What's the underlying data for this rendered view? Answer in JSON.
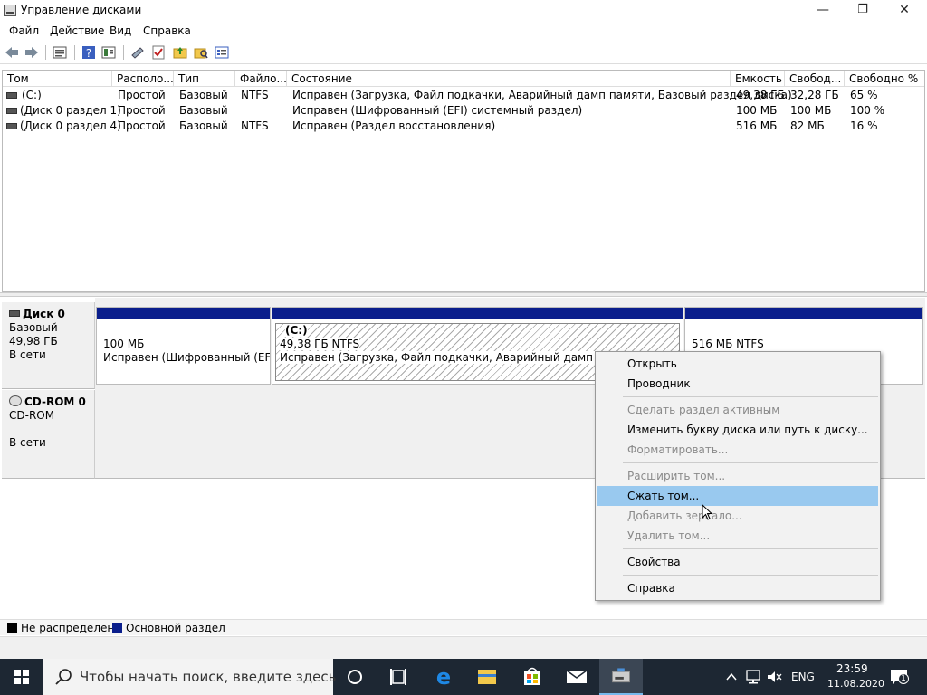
{
  "window": {
    "title": "Управление дисками",
    "minimize": "—",
    "maximize": "❐",
    "close": "✕"
  },
  "menu": [
    "Файл",
    "Действие",
    "Вид",
    "Справка"
  ],
  "list": {
    "columns": [
      "Том",
      "Располо...",
      "Тип",
      "Файло...",
      "Состояние",
      "Емкость",
      "Свобод...",
      "Свободно %"
    ],
    "rows": [
      [
        "(C:)",
        "Простой",
        "Базовый",
        "NTFS",
        "Исправен (Загрузка, Файл подкачки, Аварийный дамп памяти, Базовый раздел диска)",
        "49,38 ГБ",
        "32,28 ГБ",
        "65 %"
      ],
      [
        "(Диск 0 раздел 1)",
        "Простой",
        "Базовый",
        "",
        "Исправен (Шифрованный (EFI) системный раздел)",
        "100 МБ",
        "100 МБ",
        "100 %"
      ],
      [
        "(Диск 0 раздел 4)",
        "Простой",
        "Базовый",
        "NTFS",
        "Исправен (Раздел восстановления)",
        "516 МБ",
        "82 МБ",
        "16 %"
      ]
    ]
  },
  "disk0": {
    "name": "Диск 0",
    "type": "Базовый",
    "size": "49,98 ГБ",
    "status": "В сети",
    "p1": {
      "size": "100 МБ",
      "status": "Исправен (Шифрованный (EFI) с"
    },
    "p2": {
      "label": "(C:)",
      "size": "49,38 ГБ NTFS",
      "status": "Исправен (Загрузка, Файл подкачки, Аварийный дамп памяти,"
    },
    "p3": {
      "size": "516 МБ NTFS"
    }
  },
  "cdrom0": {
    "name": "CD-ROM 0",
    "type": "CD-ROM",
    "status": "В сети"
  },
  "legend": {
    "unallocated": "Не распределена",
    "primary": "Основной раздел",
    "unallocated_color": "#000000",
    "primary_color": "#0a1e8c"
  },
  "context_menu": {
    "open": "Открыть",
    "explorer": "Проводник",
    "mark_active": "Сделать раздел активным",
    "change_letter": "Изменить букву диска или путь к диску...",
    "format": "Форматировать...",
    "extend": "Расширить том...",
    "shrink": "Сжать том...",
    "add_mirror": "Добавить зеркало...",
    "delete": "Удалить том...",
    "properties": "Свойства",
    "help": "Справка"
  },
  "taskbar": {
    "search_placeholder": "Чтобы начать поиск, введите здесь",
    "lang": "ENG",
    "time": "23:59",
    "date": "11.08.2020",
    "notifications": "1"
  },
  "colors": {
    "accent": "#0a1e8c",
    "highlight": "#99c9ef",
    "taskbar": "#1d2733"
  }
}
